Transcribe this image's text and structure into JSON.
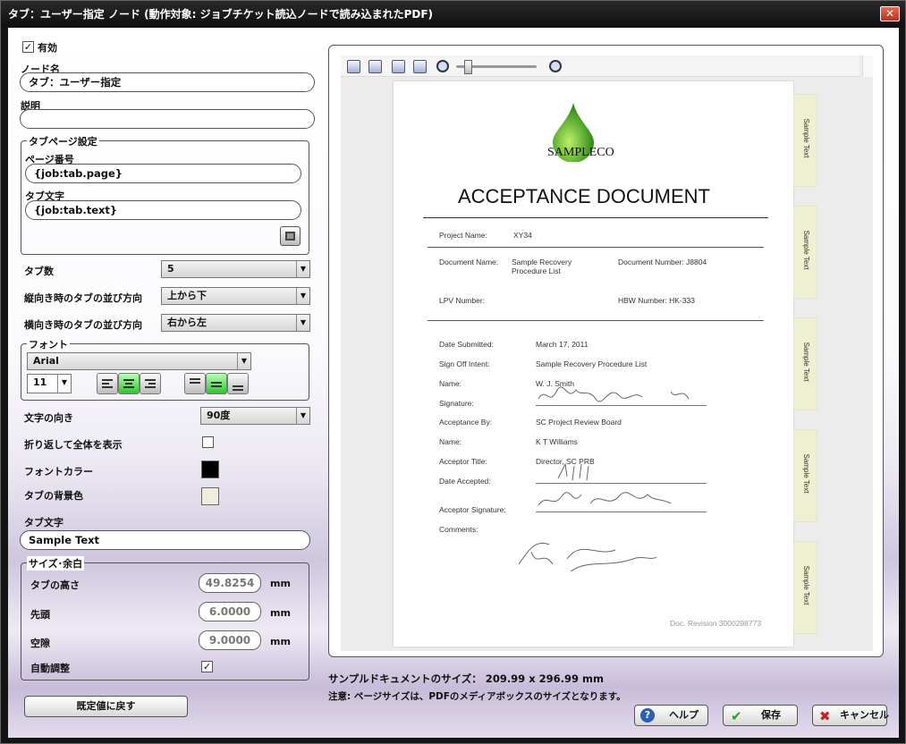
{
  "window": {
    "title": "タブ：ユーザー指定 ノード (動作対象: ジョブチケット読込ノードで読み込まれたPDF)",
    "close_glyph": "✕"
  },
  "left": {
    "enabled_label": "有効",
    "enabled_checked": "✓",
    "node_name_label": "ノード名",
    "node_name_value": "タブ：ユーザー指定",
    "description_label": "説明",
    "description_value": "",
    "tab_page_settings": {
      "legend": "タブページ設定",
      "page_number_label": "ページ番号",
      "page_number_value": "{job:tab.page}",
      "tab_text_label": "タブ文字",
      "tab_text_value": "{job:tab.text}"
    },
    "tab_count": {
      "label": "タブ数",
      "value": "5"
    },
    "portrait_order": {
      "label": "縦向き時のタブの並び方向",
      "value": "上から下"
    },
    "landscape_order": {
      "label": "横向き時のタブの並び方向",
      "value": "右から左"
    },
    "font": {
      "legend": "フォント",
      "family": "Arial",
      "size": "11"
    },
    "text_direction": {
      "label": "文字の向き",
      "value": "90度"
    },
    "wrap_label": "折り返して全体を表示",
    "wrap_checked": "",
    "font_color_label": "フォントカラー",
    "font_color": "#000000",
    "tab_bg_label": "タブの背景色",
    "tab_bg": "#eeeedd",
    "tab_text2_label": "タブ文字",
    "tab_text2_value": "Sample Text",
    "size_margin": {
      "legend": "サイズ･余白",
      "height_label": "タブの高さ",
      "height_value": "49.8254",
      "lead_label": "先頭",
      "lead_value": "6.0000",
      "gap_label": "空隙",
      "gap_value": "9.0000",
      "unit": "mm",
      "auto_label": "自動調整",
      "auto_checked": "✓"
    },
    "reset_button": "既定値に戻す"
  },
  "preview": {
    "zoom_level": 0.1,
    "doc": {
      "logo_text": "SAMPLECO",
      "title": "ACCEPTANCE DOCUMENT",
      "project_name_label": "Project Name:",
      "project_name": "XY34",
      "document_name_label": "Document Name:",
      "document_name_1": "Sample Recovery",
      "document_name_2": "Procedure List",
      "document_number": "Document Number: J8804",
      "lpv_label": "LPV Number:",
      "hbw": "HBW Number: HK-333",
      "date_submitted_label": "Date Submitted:",
      "date_submitted": "March 17, 2011",
      "sign_off_label": "Sign Off Intent:",
      "sign_off": "Sample Recovery Procedure List",
      "name1_label": "Name:",
      "name1": "W. J. Smith",
      "signature_label": "Signature:",
      "acceptance_by_label": "Acceptance By:",
      "acceptance_by": "SC Project Review Board",
      "name2_label": "Name:",
      "name2": "K T Williams",
      "acceptor_title_label": "Acceptor Title:",
      "acceptor_title": "Director, SC PRB",
      "date_accepted_label": "Date Accepted:",
      "acceptor_sig_label": "Acceptor Signature:",
      "comments_label": "Comments:",
      "revision": "Doc. Revision 3000298773"
    },
    "tab_text": "Sample Text",
    "tab_count": 5
  },
  "info": {
    "sample_size": "サンプルドキュメントのサイズ： 209.99 x 296.99 mm",
    "note": "注意: ページサイズは、PDFのメディアボックスのサイズとなります。"
  },
  "buttons": {
    "help": "ヘルプ",
    "save": "保存",
    "cancel": "キャンセル"
  }
}
